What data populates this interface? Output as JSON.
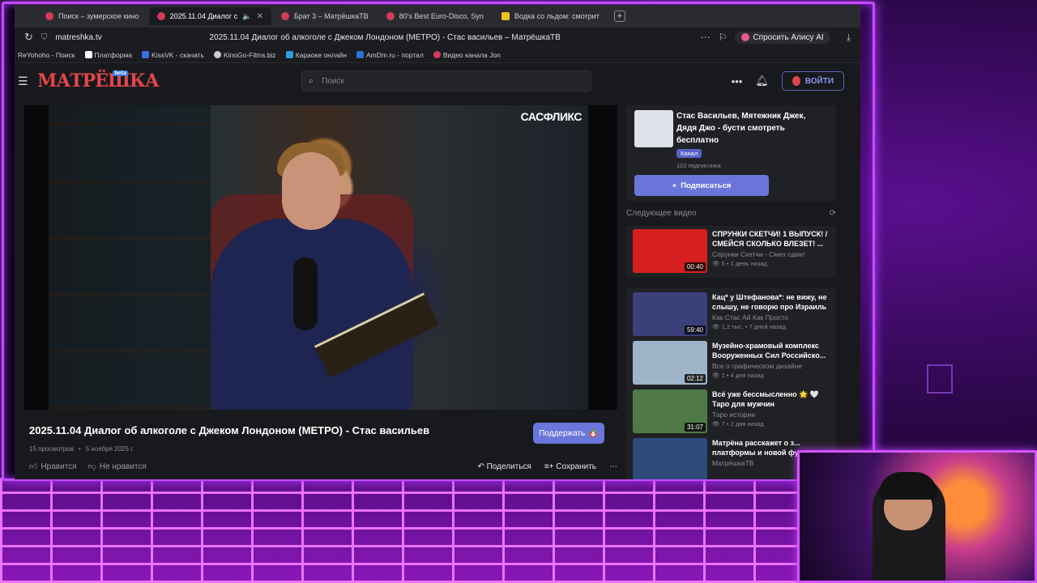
{
  "browser": {
    "tabs": [
      {
        "title": "Поиск – зумерское кино"
      },
      {
        "title": "2025.11.04 Диалог с"
      },
      {
        "title": "Брат 3 – МатрёшкаТВ"
      },
      {
        "title": "80's Best Euro-Disco, Syn"
      },
      {
        "title": "Водка со льдом: смотрит"
      }
    ],
    "domain": "matreshka.tv",
    "page_title": "2025.11.04 Диалог об алкоголе с Джеком Лондоном (МЕТРО) - Стас васильев – МатрёшкаТВ",
    "alice_label": "Спросить Алису AI",
    "bookmarks": [
      "ReYohoho - Поиск",
      "Платформа",
      "KissVK - скачать",
      "KinoGo-Films.biz",
      "Караоке онлайн",
      "AmDm.ru - портал",
      "Видео канала Jon"
    ]
  },
  "site": {
    "logo": "МАТРЁШКА",
    "logo_badge": "beta",
    "search_placeholder": "Поиск",
    "login_label": "ВОЙТИ"
  },
  "video": {
    "watermark": "САСФЛИКС",
    "title": "2025.11.04 Диалог об алкоголе с Джеком Лондоном (МЕТРО) - Стас васильев",
    "views": "15 просмотров",
    "date": "5 ноября 2025 г.",
    "support_label": "Поддержать",
    "like_label": "Нравится",
    "dislike_label": "Не нравится",
    "share_label": "Поделиться",
    "save_label": "Сохранить"
  },
  "channel": {
    "name": "Стас Васильев, Мятежник Джек, Дядя Джо - бусти смотреть бесплатно",
    "badge": "Канал",
    "subscribers": "102 подписчика",
    "subscribe_label": "Подписаться"
  },
  "next_heading": "Следующее видео",
  "next_video": {
    "title": "СПРУНКИ СКЕТЧИ! 1 ВЫПУСК! / СМЕЙСЯ СКОЛЬКО ВЛЕЗЕТ! ...",
    "channel": "Спрунки Скетчи - Смех один!",
    "stats": "5 • 1 день назад",
    "duration": "00:40",
    "color": "#d62020"
  },
  "recommended": [
    {
      "title": "Кац* у Штефанова*: не вижу, не слышу, не говорю про Израиль",
      "channel": "Как Стас Ай Как Просто",
      "stats": "1,2 тыс. • 7 дней назад",
      "duration": "59:40",
      "color": "#3b3f7a"
    },
    {
      "title": "Музейно-храмовый комплекс Вооруженных Сил Российско...",
      "channel": "Все о графическом дизайне",
      "stats": "1 • 4 дня назад",
      "duration": "02:12",
      "color": "#9fb3c9"
    },
    {
      "title": "Всё уже бессмысленно 🌟 🤍 Таро для мужчин",
      "channel": "Таро истории",
      "stats": "7 • 2 дня назад",
      "duration": "31:07",
      "color": "#4f7a45"
    },
    {
      "title": "Матрёна расскажет о з... платформы и новой фу...",
      "channel": "МатрёшкаТВ",
      "stats": "",
      "duration": "",
      "color": "#2c4a7a"
    }
  ]
}
